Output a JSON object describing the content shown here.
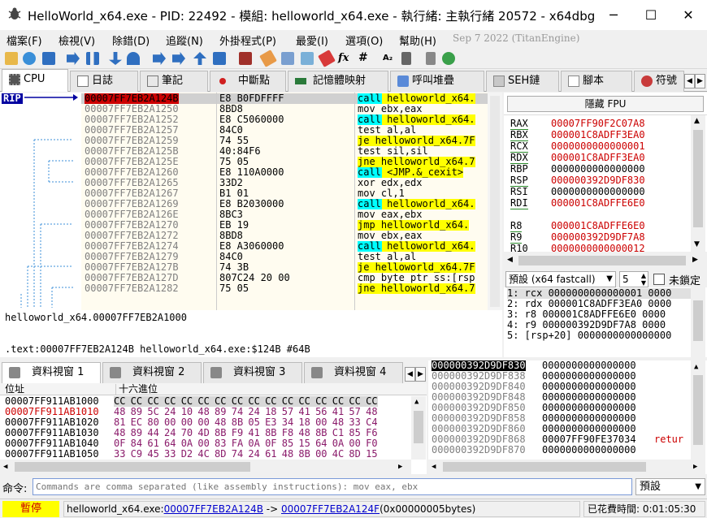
{
  "window": {
    "title": "HelloWorld_x64.exe - PID: 22492 - 模組: helloworld_x64.exe - 執行緒: 主執行緒 20572 - x64dbg"
  },
  "menu": [
    "檔案(F)",
    "檢視(V)",
    "除錯(D)",
    "追蹤(N)",
    "外掛程式(P)",
    "最愛(I)",
    "選項(O)",
    "幫助(H)",
    "Sep 7 2022 (TitanEngine)"
  ],
  "tabs": [
    "CPU",
    "日誌",
    "筆記",
    "中斷點",
    "記憶體映射",
    "呼叫堆疊",
    "SEH鏈",
    "腳本",
    "符號"
  ],
  "disasm": [
    {
      "addr": "00007FF7EB2A124B",
      "bytes": "E8 B0FDFFFF",
      "ins": "call helloworld_x64."
    },
    {
      "addr": "00007FF7EB2A1250",
      "bytes": "8BD8",
      "ins": "mov ebx,eax"
    },
    {
      "addr": "00007FF7EB2A1252",
      "bytes": "E8 C5060000",
      "ins": "call helloworld_x64."
    },
    {
      "addr": "00007FF7EB2A1257",
      "bytes": "84C0",
      "ins": "test al,al"
    },
    {
      "addr": "00007FF7EB2A1259",
      "bytes": "74 55",
      "ins": "je helloworld_x64.7F"
    },
    {
      "addr": "00007FF7EB2A125B",
      "bytes": "40:84F6",
      "ins": "test sil,sil"
    },
    {
      "addr": "00007FF7EB2A125E",
      "bytes": "75 05",
      "ins": "jne helloworld_x64.7"
    },
    {
      "addr": "00007FF7EB2A1260",
      "bytes": "E8 110A0000",
      "ins": "call <JMP.&_cexit>"
    },
    {
      "addr": "00007FF7EB2A1265",
      "bytes": "33D2",
      "ins": "xor edx,edx"
    },
    {
      "addr": "00007FF7EB2A1267",
      "bytes": "B1 01",
      "ins": "mov cl,1"
    },
    {
      "addr": "00007FF7EB2A1269",
      "bytes": "E8 B2030000",
      "ins": "call helloworld_x64."
    },
    {
      "addr": "00007FF7EB2A126E",
      "bytes": "8BC3",
      "ins": "mov eax,ebx"
    },
    {
      "addr": "00007FF7EB2A1270",
      "bytes": "EB 19",
      "ins": "jmp helloworld_x64."
    },
    {
      "addr": "00007FF7EB2A1272",
      "bytes": "8BD8",
      "ins": "mov ebx,eax"
    },
    {
      "addr": "00007FF7EB2A1274",
      "bytes": "E8 A3060000",
      "ins": "call helloworld_x64."
    },
    {
      "addr": "00007FF7EB2A1279",
      "bytes": "84C0",
      "ins": "test al,al"
    },
    {
      "addr": "00007FF7EB2A127B",
      "bytes": "74 3B",
      "ins": "je helloworld_x64.7F"
    },
    {
      "addr": "00007FF7EB2A127D",
      "bytes": "807C24 20 00",
      "ins": "cmp byte ptr ss:[rsp"
    },
    {
      "addr": "00007FF7EB2A1282",
      "bytes": "75 05",
      "ins": "jne helloworld_x64.7"
    }
  ],
  "rip_label": "RIP",
  "fpu_label": "隱藏 FPU",
  "registers": [
    {
      "name": "RAX",
      "value": "00007FF90F2C07A8",
      "changed": true
    },
    {
      "name": "RBX",
      "value": "000001C8ADFF3EA0",
      "changed": true
    },
    {
      "name": "RCX",
      "value": "0000000000000001",
      "changed": true
    },
    {
      "name": "RDX",
      "value": "000001C8ADFF3EA0",
      "changed": true
    },
    {
      "name": "RBP",
      "value": "0000000000000000",
      "changed": false
    },
    {
      "name": "RSP",
      "value": "000000392D9DF830",
      "changed": true
    },
    {
      "name": "RSI",
      "value": "0000000000000000",
      "changed": false
    },
    {
      "name": "RDI",
      "value": "000001C8ADFFE6E0",
      "changed": true
    },
    {
      "name": "",
      "value": "",
      "changed": false
    },
    {
      "name": "R8",
      "value": "000001C8ADFFE6E0",
      "changed": true
    },
    {
      "name": "R9",
      "value": "000000392D9DF7A8",
      "changed": true
    },
    {
      "name": "R10",
      "value": "0000000000000012",
      "changed": true
    }
  ],
  "callconv": {
    "label": "預設 (x64 fastcall)",
    "count": "5",
    "lock_label": "未鎖定"
  },
  "stackargs": [
    "1: rcx 0000000000000001 0000",
    "2: rdx 000001C8ADFF3EA0 0000",
    "3: r8 000001C8ADFFE6E0 0000",
    "4: r9 000000392D9DF7A8 0000",
    "5: [rsp+20] 0000000000000000"
  ],
  "info": {
    "line1": "helloworld_x64.00007FF7EB2A1000",
    "line2": ".text:00007FF7EB2A124B helloworld_x64.exe:$124B #64B"
  },
  "dump_tabs": [
    "資料視窗 1",
    "資料視窗 2",
    "資料視窗 3",
    "資料視窗 4"
  ],
  "dump": {
    "col_addr": "位址",
    "col_hex": "十六進位",
    "rows": [
      {
        "addr": "00007FF911AB1000",
        "hex": "CC CC CC CC CC CC CC CC CC CC CC CC CC CC CC CC",
        "red": false
      },
      {
        "addr": "00007FF911AB1010",
        "hex": "48 89 5C 24 10 48 89 74 24 18 57 41 56 41 57 48",
        "red": true
      },
      {
        "addr": "00007FF911AB1020",
        "hex": "81 EC 80 00 00 00 48 8B 05 E3 34 18 00 48 33 C4",
        "red": false
      },
      {
        "addr": "00007FF911AB1030",
        "hex": "48 89 44 24 70 4D 8B F9 41 8B F8 48 8B C1 85 F6",
        "red": false
      },
      {
        "addr": "00007FF911AB1040",
        "hex": "0F 84 61 64 0A 00 83 FA 0A 0F 85 15 64 0A 00 F0",
        "red": false
      },
      {
        "addr": "00007FF911AB1050",
        "hex": "33 C9 45 33 D2 4C 8D 74 24 61 48 8B 00 4C 8D 15",
        "red": false
      }
    ]
  },
  "stack": [
    {
      "addr": "000000392D9DF830",
      "value": "0000000000000000",
      "comment": ""
    },
    {
      "addr": "000000392D9DF838",
      "value": "0000000000000000",
      "comment": ""
    },
    {
      "addr": "000000392D9DF840",
      "value": "0000000000000000",
      "comment": ""
    },
    {
      "addr": "000000392D9DF848",
      "value": "0000000000000000",
      "comment": ""
    },
    {
      "addr": "000000392D9DF850",
      "value": "0000000000000000",
      "comment": ""
    },
    {
      "addr": "000000392D9DF858",
      "value": "0000000000000000",
      "comment": ""
    },
    {
      "addr": "000000392D9DF860",
      "value": "0000000000000000",
      "comment": ""
    },
    {
      "addr": "000000392D9DF868",
      "value": "00007FF90FE37034",
      "comment": "retur"
    },
    {
      "addr": "000000392D9DF870",
      "value": "0000000000000000",
      "comment": ""
    }
  ],
  "command": {
    "label": "命令:",
    "placeholder": "Commands are comma separated (like assembly instructions): mov eax, ebx",
    "mode": "預設"
  },
  "status": {
    "state": "暫停",
    "module": "helloworld_x64.exe:",
    "from": "00007FF7EB2A124B",
    "arrow": " -> ",
    "to": "00007FF7EB2A124F",
    "size": "(0x00000005bytes)",
    "elapsed": "已花費時間: 0:01:05:30"
  },
  "colors": {
    "selected": "#cc0000",
    "call": "#00ffff",
    "jump": "#ffff00"
  }
}
